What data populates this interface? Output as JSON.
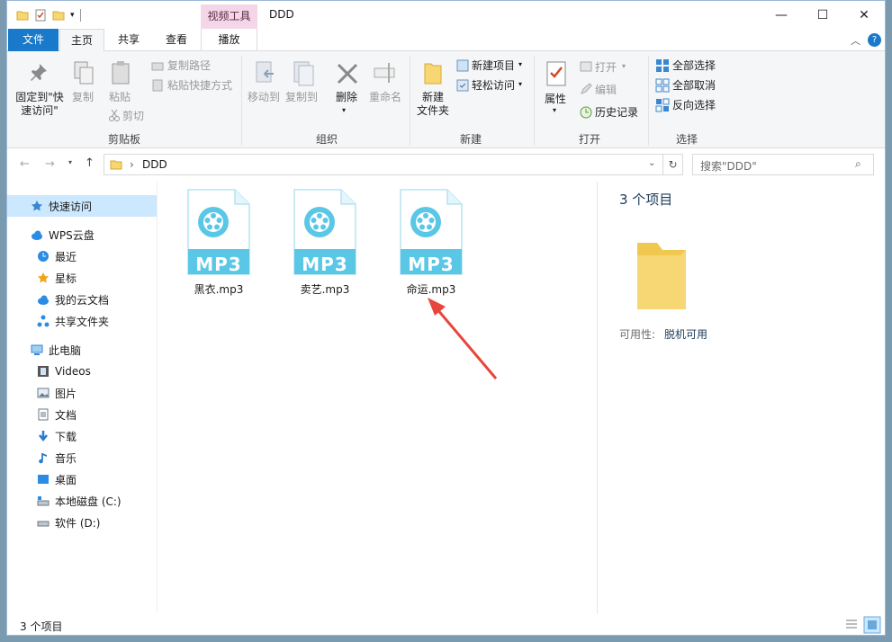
{
  "window": {
    "title": "DDD",
    "context_tab_group": "视频工具",
    "minimize": "—",
    "maximize": "☐",
    "close": "✕"
  },
  "tabs": {
    "file": "文件",
    "home": "主页",
    "share": "共享",
    "view": "查看",
    "play": "播放"
  },
  "ribbon": {
    "clipboard": {
      "pin": "固定到\"快\n速访问\"",
      "copy": "复制",
      "paste": "粘贴",
      "copy_path": "复制路径",
      "paste_shortcut": "粘贴快捷方式",
      "cut": "剪切",
      "label": "剪贴板"
    },
    "organize": {
      "move_to": "移动到",
      "copy_to": "复制到",
      "delete": "删除",
      "rename": "重命名",
      "label": "组织"
    },
    "new": {
      "new_folder": "新建\n文件夹",
      "new_item": "新建项目",
      "easy_access": "轻松访问",
      "label": "新建"
    },
    "open": {
      "properties": "属性",
      "open": "打开",
      "edit": "编辑",
      "history": "历史记录",
      "label": "打开"
    },
    "select": {
      "select_all": "全部选择",
      "select_none": "全部取消",
      "invert": "反向选择",
      "label": "选择"
    }
  },
  "address": {
    "path": "DDD",
    "search_placeholder": "搜索\"DDD\""
  },
  "nav": {
    "quick_access": "快速访问",
    "wps": "WPS云盘",
    "recent": "最近",
    "starred": "星标",
    "my_cloud": "我的云文档",
    "shared": "共享文件夹",
    "this_pc": "此电脑",
    "videos": "Videos",
    "pictures": "图片",
    "documents": "文档",
    "downloads": "下载",
    "music": "音乐",
    "desktop": "桌面",
    "local_c": "本地磁盘 (C:)",
    "software_d": "软件 (D:)"
  },
  "files": [
    {
      "name": "黑衣.mp3",
      "badge": "MP3"
    },
    {
      "name": "卖艺.mp3",
      "badge": "MP3"
    },
    {
      "name": "命运.mp3",
      "badge": "MP3"
    }
  ],
  "preview": {
    "count": "3 个项目",
    "availability_label": "可用性:",
    "availability_value": "脱机可用"
  },
  "status": {
    "count": "3 个项目"
  },
  "colors": {
    "accent": "#1979ca",
    "file_icon": "#5bc7e6",
    "arrow": "#e8453c"
  }
}
